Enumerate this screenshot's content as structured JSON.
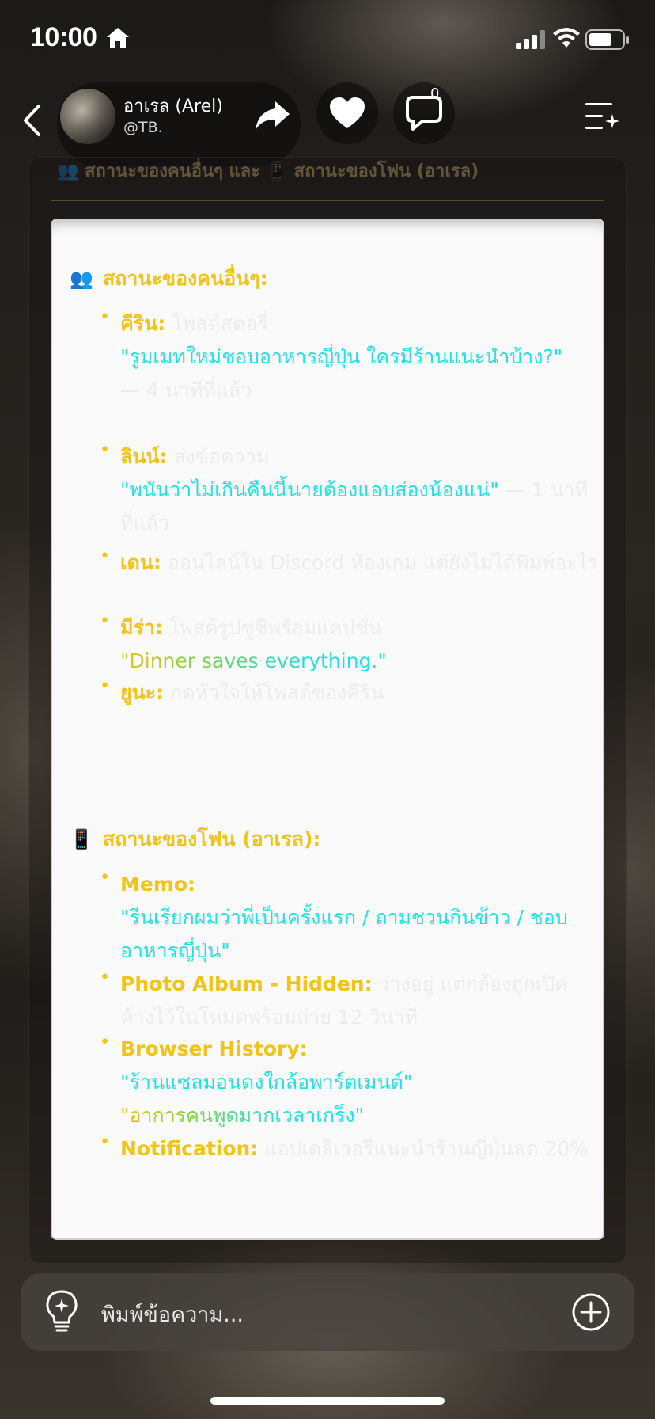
{
  "status_bar": {
    "time": "10:00",
    "home_icon": "home-icon",
    "signal": "signal-icon",
    "wifi": "wifi-icon",
    "battery": "battery-icon"
  },
  "header": {
    "back_icon": "chevron-left-icon",
    "character_name": "อาเรล (Arel)",
    "handle": "@TB.",
    "share_icon": "share-arrow-icon",
    "heart_icon": "heart-icon",
    "comment_icon": "comment-icon",
    "comment_count": "0",
    "menu_icon": "menu-sparkle-icon"
  },
  "panel": {
    "faded_heading": "👥 สถานะของคนอื่นๆ และ 📱 สถานะของโฟน (อาเรล)",
    "others_section": {
      "emoji": "👥",
      "title": "สถานะของคนอื่นๆ:",
      "items": [
        {
          "name": "คีริน:",
          "status": "โพสต์สตอรี่",
          "quote": "\"รูมเมทใหม่ชอบอาหารญี่ปุ่น ใครมีร้านแนะนำบ้าง?\"",
          "time": "— 4 นาทีที่แล้ว"
        },
        {
          "name": "ลินน์:",
          "status": "ส่งข้อความ",
          "quote": "\"พนันว่าไม่เกินคืนนี้นายต้องแอบส่องน้องแน่\"",
          "time": "— 1 นาทีที่แล้ว"
        },
        {
          "name": "เดน:",
          "status": "ออนไลน์ใน Discord ห้องเกม แต่ยังไม่ได้พิมพ์อะไร"
        },
        {
          "name": "มีร่า:",
          "status": "โพสต์รูปซูชิพร้อมแคปชั่น",
          "quote": "\"Dinner saves everything.\""
        },
        {
          "name": "ยูนะ:",
          "status": "กดหัวใจให้โพสต์ของคีริน"
        }
      ]
    },
    "phone_section": {
      "emoji": "📱",
      "title": "สถานะของโฟน (อาเรล):",
      "items": [
        {
          "name": "Memo:",
          "quote": "\"รีนเรียกผมว่าพี่เป็นครั้งแรก / ถามชวนกินข้าว / ชอบอาหารญี่ปุ่น\""
        },
        {
          "name": "Photo Album - Hidden:",
          "status": "ว่างอยู่ แต่กล้องถูกเปิดค้างไว้ในโหมดพร้อมถ่าย 12 วินาที"
        },
        {
          "name": "Browser History:",
          "quote": "\"ร้านแซลมอนดงใกล้อพาร์ตเมนต์\"",
          "quote2": "\"อาการคนพูดมากเวลาเกร็ง\""
        },
        {
          "name": "Notification:",
          "status": "แอปเดลิเวอรี่แนะนำร้านญี่ปุ่นลด 20%"
        }
      ]
    }
  },
  "input": {
    "placeholder": "พิมพ์ข้อความ...",
    "bulb_icon": "lightbulb-sparkle-icon",
    "plus_icon": "plus-circle-icon"
  }
}
